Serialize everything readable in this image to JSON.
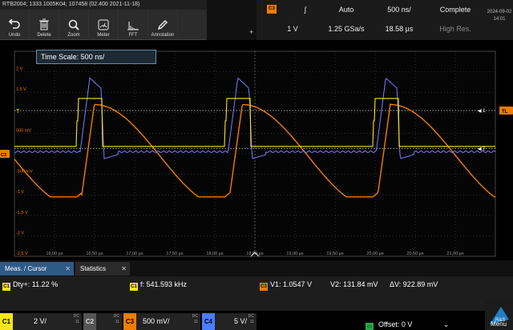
{
  "window": {
    "title": "RTB2004; 1333.1005K04; 107458 (02.400 2021-11-18)"
  },
  "toolbar": [
    {
      "label": "Undo",
      "icon": "undo-icon"
    },
    {
      "label": "Delete",
      "icon": "trash-icon"
    },
    {
      "label": "Zoom",
      "icon": "zoom-icon"
    },
    {
      "label": "Meter",
      "icon": "meter-icon"
    },
    {
      "label": "FFT",
      "icon": "fft-icon"
    },
    {
      "label": "Annotation",
      "icon": "pen-icon"
    }
  ],
  "header": {
    "channel_badge": "C3",
    "trigger_slope": "∫",
    "trigger_mode": "Auto",
    "time_per_div": "500 ns/",
    "acq_state": "Complete",
    "trigger_level": "1 V",
    "sample_rate": "1.25 GSa/s",
    "record_length": "18.58 µs",
    "acq_mode": "High Res.",
    "plus": "+"
  },
  "clock": {
    "date": "2024-09-02",
    "time": "14:01"
  },
  "plot": {
    "time_scale_label": "Time Scale: 500 ns/",
    "y_ticks": [
      "2 V",
      "1,5 V",
      "500 mV",
      "-500 mV",
      "-1 V",
      "-1,5 V",
      "-2 V",
      "-2,5 V"
    ],
    "x_ticks": [
      "16,00 µs",
      "16,50 µs",
      "17,00 µs",
      "17,50 µs",
      "18,00 µs",
      "18,50 µs",
      "19,00 µs",
      "19,50 µs",
      "20,00 µs",
      "20,50 µs",
      "21,00 µs"
    ],
    "markers": {
      "cursor1": "1",
      "cursor2": "2",
      "trigger_level": "TL",
      "trigger_pos": "T",
      "ch3": "C3"
    }
  },
  "tabs": {
    "meas": "Meas. / Cursor",
    "stats": "Statistics"
  },
  "measurements": {
    "duty": "Dty+: 11.22 %",
    "freq": "f: 541.593 kHz",
    "v1": "V1: 1.0547 V",
    "v2": "V2: 131.84 mV",
    "dv": "ΔV: 922.89 mV",
    "c1": "C1",
    "c3": "C3"
  },
  "channels": [
    {
      "name": "C1",
      "scale": "2 V/",
      "coupling": "DC",
      "bw": "11",
      "color": "#f5e51b"
    },
    {
      "name": "C2",
      "scale": "",
      "coupling": "DC",
      "bw": "11",
      "color": "#00c000"
    },
    {
      "name": "C3",
      "scale": "500 mV/",
      "coupling": "DC",
      "bw": "11",
      "color": "#f07d00"
    },
    {
      "name": "C4",
      "scale": "5 V/",
      "coupling": "DC",
      "bw": "11",
      "color": "#4a7dff"
    }
  ],
  "offset": {
    "label": "Offset: 0 V"
  },
  "menu": {
    "label": "Menu"
  },
  "colors": {
    "ch1": "#f5e51b",
    "ch3": "#f07d00",
    "ch4": "#7b7bff",
    "grid": "#4a4a4a",
    "accent": "#2e5a86"
  }
}
